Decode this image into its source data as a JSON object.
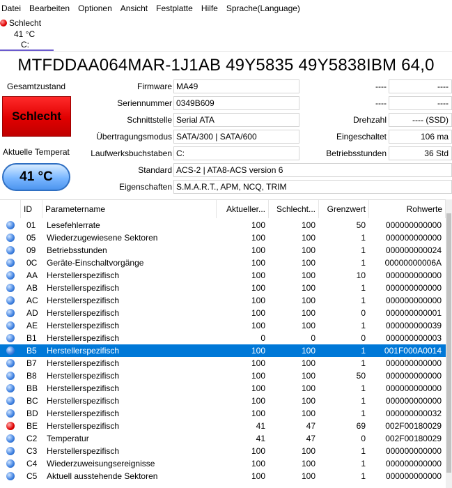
{
  "menu": [
    "Datei",
    "Bearbeiten",
    "Optionen",
    "Ansicht",
    "Festplatte",
    "Hilfe",
    "Sprache(Language)"
  ],
  "drive_tab": {
    "status": "Schlecht",
    "temperature": "41 °C",
    "letter": "C:"
  },
  "model": "MTFDDAA064MAR-1J1AB  49Y5835 49Y5838IBM 64,0",
  "health": {
    "label": "Gesamtzustand",
    "value": "Schlecht"
  },
  "temperature": {
    "label": "Aktuelle Temperat",
    "value": "41 °C"
  },
  "info": {
    "firmware": {
      "label": "Firmware",
      "value": "MA49"
    },
    "serial": {
      "label": "Seriennummer",
      "value": "0349B609"
    },
    "interface": {
      "label": "Schnittstelle",
      "value": "Serial ATA"
    },
    "transfer": {
      "label": "Übertragungsmodus",
      "value": "SATA/300 | SATA/600"
    },
    "drive_letters": {
      "label": "Laufwerksbuchstaben",
      "value": "C:"
    },
    "standard": {
      "label": "Standard",
      "value": "ACS-2 | ATA8-ACS version 6"
    },
    "features": {
      "label": "Eigenschaften",
      "value": "S.M.A.R.T., APM, NCQ, TRIM"
    },
    "right1": {
      "label": "----",
      "value": "----"
    },
    "right2": {
      "label": "----",
      "value": "----"
    },
    "rotation": {
      "label": "Drehzahl",
      "value": "---- (SSD)"
    },
    "power_on": {
      "label": "Eingeschaltet",
      "value": "106 ma"
    },
    "hours": {
      "label": "Betriebsstunden",
      "value": "36 Std"
    }
  },
  "table": {
    "headers": [
      "ID",
      "Parametername",
      "Aktueller...",
      "Schlecht...",
      "Grenzwert",
      "Rohwerte"
    ],
    "rows": [
      {
        "status": "blue",
        "id": "01",
        "name": "Lesefehlerrate",
        "current": "100",
        "worst": "100",
        "threshold": "50",
        "raw": "000000000000"
      },
      {
        "status": "blue",
        "id": "05",
        "name": "Wiederzugewiesene Sektoren",
        "current": "100",
        "worst": "100",
        "threshold": "1",
        "raw": "000000000000"
      },
      {
        "status": "blue",
        "id": "09",
        "name": "Betriebsstunden",
        "current": "100",
        "worst": "100",
        "threshold": "1",
        "raw": "000000000024"
      },
      {
        "status": "blue",
        "id": "0C",
        "name": "Geräte-Einschaltvorgänge",
        "current": "100",
        "worst": "100",
        "threshold": "1",
        "raw": "00000000006A"
      },
      {
        "status": "blue",
        "id": "AA",
        "name": "Herstellerspezifisch",
        "current": "100",
        "worst": "100",
        "threshold": "10",
        "raw": "000000000000"
      },
      {
        "status": "blue",
        "id": "AB",
        "name": "Herstellerspezifisch",
        "current": "100",
        "worst": "100",
        "threshold": "1",
        "raw": "000000000000"
      },
      {
        "status": "blue",
        "id": "AC",
        "name": "Herstellerspezifisch",
        "current": "100",
        "worst": "100",
        "threshold": "1",
        "raw": "000000000000"
      },
      {
        "status": "blue",
        "id": "AD",
        "name": "Herstellerspezifisch",
        "current": "100",
        "worst": "100",
        "threshold": "0",
        "raw": "000000000001"
      },
      {
        "status": "blue",
        "id": "AE",
        "name": "Herstellerspezifisch",
        "current": "100",
        "worst": "100",
        "threshold": "1",
        "raw": "000000000039"
      },
      {
        "status": "blue",
        "id": "B1",
        "name": "Herstellerspezifisch",
        "current": "0",
        "worst": "0",
        "threshold": "0",
        "raw": "000000000003"
      },
      {
        "status": "blue",
        "id": "B5",
        "name": "Herstellerspezifisch",
        "current": "100",
        "worst": "100",
        "threshold": "1",
        "raw": "001F000A0014",
        "selected": true
      },
      {
        "status": "blue",
        "id": "B7",
        "name": "Herstellerspezifisch",
        "current": "100",
        "worst": "100",
        "threshold": "1",
        "raw": "000000000000"
      },
      {
        "status": "blue",
        "id": "B8",
        "name": "Herstellerspezifisch",
        "current": "100",
        "worst": "100",
        "threshold": "50",
        "raw": "000000000000"
      },
      {
        "status": "blue",
        "id": "BB",
        "name": "Herstellerspezifisch",
        "current": "100",
        "worst": "100",
        "threshold": "1",
        "raw": "000000000000"
      },
      {
        "status": "blue",
        "id": "BC",
        "name": "Herstellerspezifisch",
        "current": "100",
        "worst": "100",
        "threshold": "1",
        "raw": "000000000000"
      },
      {
        "status": "blue",
        "id": "BD",
        "name": "Herstellerspezifisch",
        "current": "100",
        "worst": "100",
        "threshold": "1",
        "raw": "000000000032"
      },
      {
        "status": "red",
        "id": "BE",
        "name": "Herstellerspezifisch",
        "current": "41",
        "worst": "47",
        "threshold": "69",
        "raw": "002F00180029"
      },
      {
        "status": "blue",
        "id": "C2",
        "name": "Temperatur",
        "current": "41",
        "worst": "47",
        "threshold": "0",
        "raw": "002F00180029"
      },
      {
        "status": "blue",
        "id": "C3",
        "name": "Herstellerspezifisch",
        "current": "100",
        "worst": "100",
        "threshold": "1",
        "raw": "000000000000"
      },
      {
        "status": "blue",
        "id": "C4",
        "name": "Wiederzuweisungsereignisse",
        "current": "100",
        "worst": "100",
        "threshold": "1",
        "raw": "000000000000"
      },
      {
        "status": "blue",
        "id": "C5",
        "name": "Aktuell ausstehende Sektoren",
        "current": "100",
        "worst": "100",
        "threshold": "1",
        "raw": "000000000000"
      }
    ]
  },
  "colors": {
    "bad": "#e00000",
    "good": "#3c7fe0",
    "selection": "#0078d7"
  }
}
